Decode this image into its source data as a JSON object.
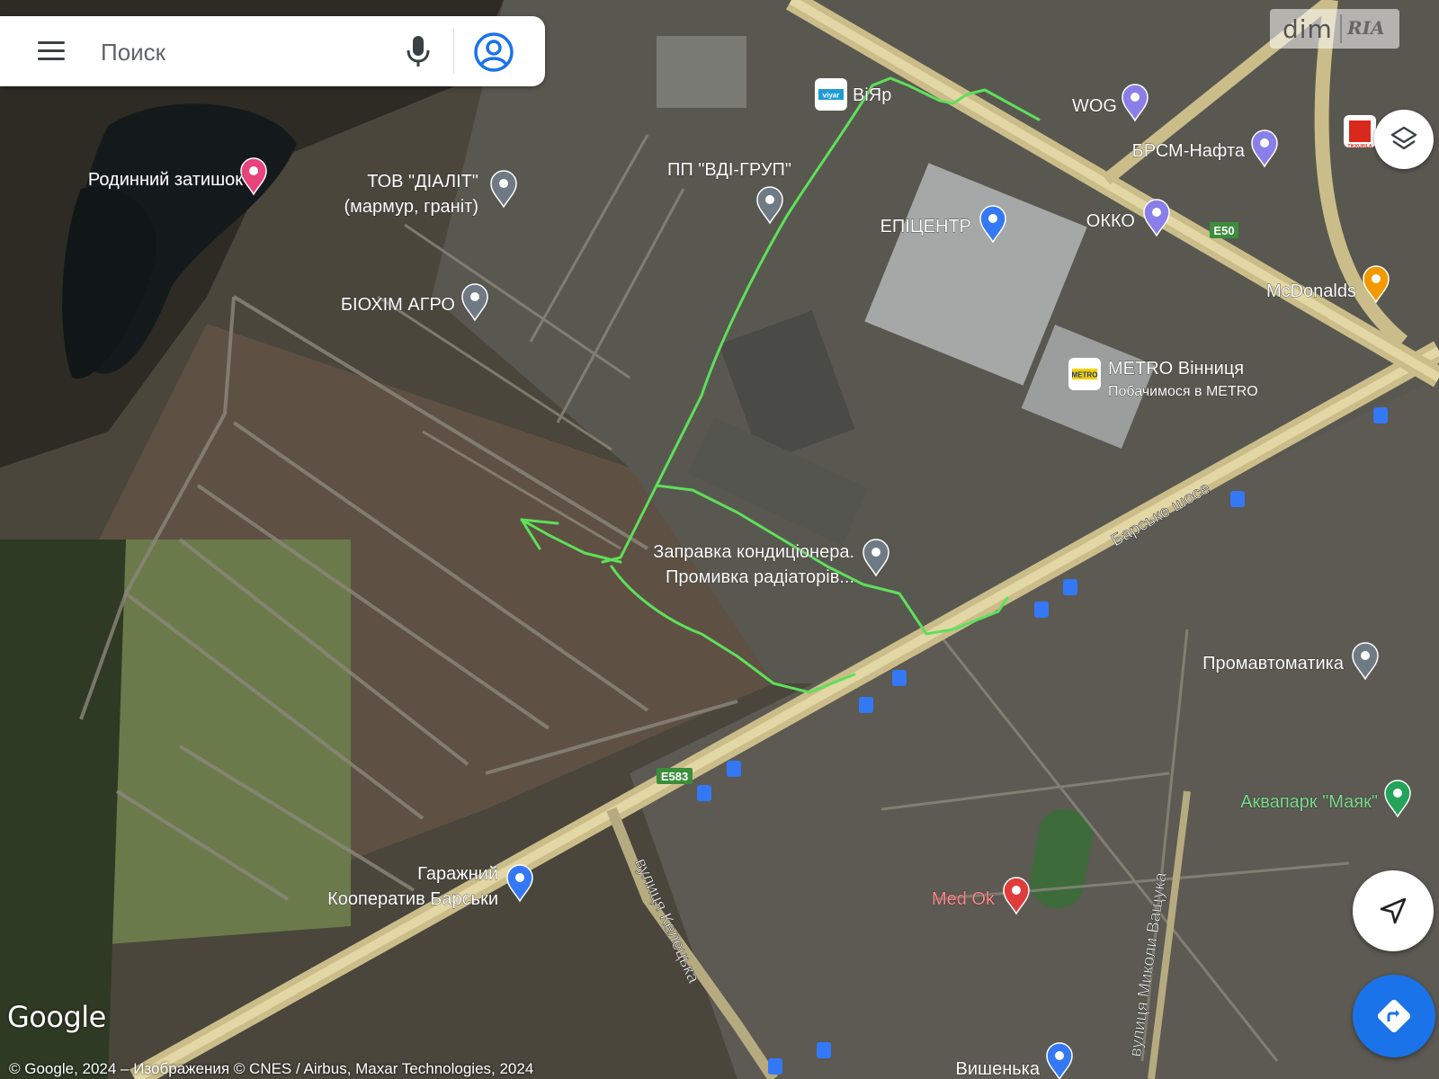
{
  "search": {
    "placeholder": "Поиск"
  },
  "watermark": {
    "left": "dim",
    "right": "RIA"
  },
  "places": [
    {
      "name": "Родинний затишок",
      "icon": "hotel-pin-icon"
    },
    {
      "name": "ТОВ \"ДІАЛІТ\"",
      "name2": "(мармур, граніт)",
      "icon": "place-pin-icon"
    },
    {
      "name": "ПП \"ВДІ-ГРУП\"",
      "icon": "place-pin-icon"
    },
    {
      "name": "ВіЯр",
      "icon": "viyar-logo-icon",
      "logo_text": "viyar"
    },
    {
      "name": "WOG",
      "icon": "fuel-pin-icon"
    },
    {
      "name": "БРСМ-Нафта",
      "icon": "fuel-pin-icon"
    },
    {
      "name": "ЕПІЦЕНТР",
      "icon": "shopping-pin-icon"
    },
    {
      "name": "ОККО",
      "icon": "fuel-pin-icon"
    },
    {
      "name": "McDonalds",
      "icon": "restaurant-pin-icon"
    },
    {
      "name": "БІОХІМ АГРО",
      "icon": "place-pin-icon"
    },
    {
      "name": "METRO Вінниця",
      "name2": "Побачимося в METRO",
      "icon": "metro-logo-icon",
      "logo_text": "METRO"
    },
    {
      "name": "Заправка кондиціонера.",
      "name2": "Промивка радіаторів...",
      "icon": "place-pin-icon"
    },
    {
      "name": "Промавтоматика",
      "icon": "museum-pin-icon"
    },
    {
      "name": "Аквапарк \"Маяк\"",
      "icon": "park-pin-icon"
    },
    {
      "name": "Гаражний",
      "name2": "Кооператив Барськи",
      "icon": "parking-pin-icon"
    },
    {
      "name": "Med Ok",
      "icon": "hospital-pin-icon"
    },
    {
      "name": "Вишенька",
      "icon": "shopping-bag-pin-icon"
    }
  ],
  "roads": {
    "barske": "Барське шосе",
    "keletska": "вулиця Келецька",
    "vashchuka": "вулиця Миколи Ващука",
    "e50": "E50",
    "e583": "E583"
  },
  "route": {
    "color": "#5ee05a"
  },
  "tikkurila_label": "TIKKURILA",
  "google_logo": "Google",
  "copyright": "© Google, 2024 – Изображения © CNES / Airbus, Maxar Technologies, 2024"
}
